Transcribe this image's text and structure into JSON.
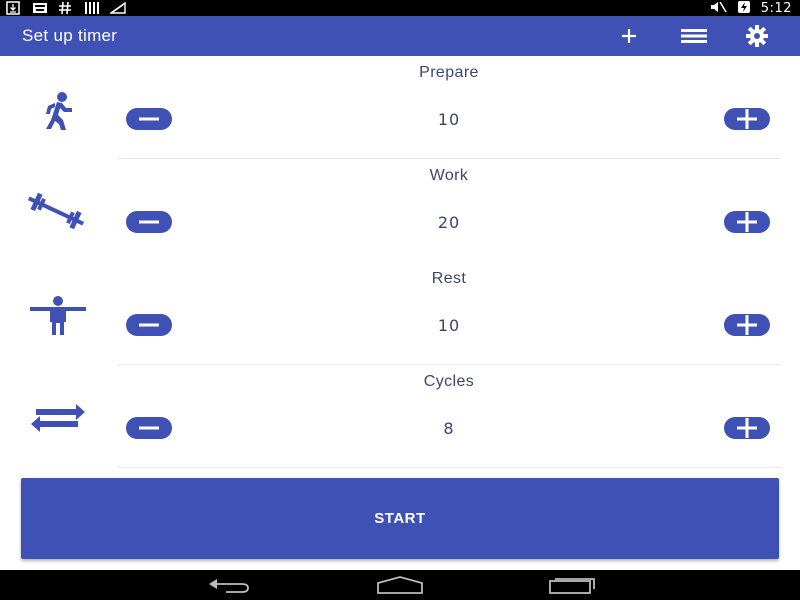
{
  "status_bar": {
    "left_icons": [
      "download-icon",
      "keyboard-icon",
      "hash-icon",
      "barcode-icon",
      "wifi-signal-icon"
    ],
    "time": "5:12"
  },
  "app_bar": {
    "title": "Set up timer",
    "actions": [
      "add-icon",
      "list-icon",
      "settings-gear-icon"
    ]
  },
  "rows": [
    {
      "label": "Prepare",
      "value": "10",
      "icon": "walking-person-icon"
    },
    {
      "label": "Work",
      "value": "20",
      "icon": "barbell-icon"
    },
    {
      "label": "Rest",
      "value": "10",
      "icon": "standing-person-icon"
    },
    {
      "label": "Cycles",
      "value": "8",
      "icon": "repeat-arrows-icon"
    }
  ],
  "start_label": "START",
  "colors": {
    "primary": "#3f51b5",
    "text": "#3b4670"
  }
}
